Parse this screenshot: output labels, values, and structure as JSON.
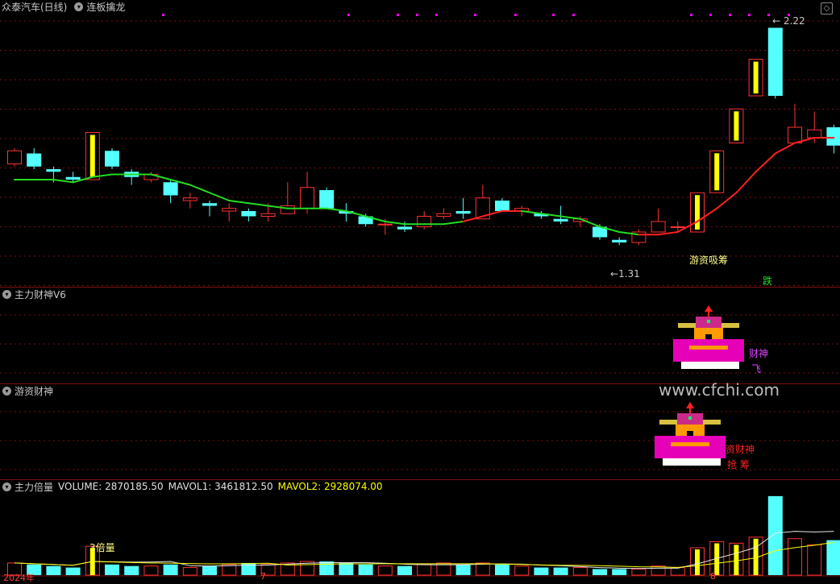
{
  "main": {
    "stock": "众泰汽车(日线)",
    "indicator": "连板擒龙",
    "high_label": "2.22",
    "low_label": "1.31",
    "annotation": "游资吸筹",
    "signal": "跌"
  },
  "panel2": {
    "title": "主力财神V6",
    "figure_text_1": "财神",
    "figure_text_2": "飞"
  },
  "panel3": {
    "title": "游资财神",
    "figure_text_1": "资财神",
    "figure_text_2": "抢 筹"
  },
  "panel4": {
    "title": "主力倍量",
    "volume": "VOLUME: 2870185.50",
    "mavol1": "MAVOL1: 3461812.50",
    "mavol2": "MAVOL2: 2928074.00",
    "marker": "3倍量"
  },
  "axis": {
    "year_label": "2024年",
    "m7": "7",
    "m8": "8"
  },
  "watermark": "www.cfchi.com",
  "colors": {
    "up": "#ff3232",
    "down": "#54ffff",
    "yellow": "#ffff00",
    "magenta": "#ff00ff",
    "ma_green": "#22dd22",
    "ma_red": "#ff2020"
  },
  "chart_data": {
    "type": "candlestick",
    "candles": [
      {
        "o": 1.7,
        "c": 1.75,
        "h": 1.76,
        "l": 1.69
      },
      {
        "o": 1.74,
        "c": 1.69,
        "h": 1.76,
        "l": 1.68
      },
      {
        "o": 1.68,
        "c": 1.67,
        "h": 1.69,
        "l": 1.63
      },
      {
        "o": 1.65,
        "c": 1.64,
        "h": 1.67,
        "l": 1.63
      },
      {
        "o": 1.64,
        "c": 1.82,
        "h": 1.82,
        "l": 1.64,
        "limit": true
      },
      {
        "o": 1.75,
        "c": 1.69,
        "h": 1.76,
        "l": 1.68
      },
      {
        "o": 1.67,
        "c": 1.65,
        "h": 1.68,
        "l": 1.62
      },
      {
        "o": 1.64,
        "c": 1.66,
        "h": 1.67,
        "l": 1.63
      },
      {
        "o": 1.63,
        "c": 1.58,
        "h": 1.64,
        "l": 1.55
      },
      {
        "o": 1.56,
        "c": 1.57,
        "h": 1.59,
        "l": 1.53
      },
      {
        "o": 1.55,
        "c": 1.54,
        "h": 1.56,
        "l": 1.5
      },
      {
        "o": 1.52,
        "c": 1.53,
        "h": 1.55,
        "l": 1.48
      },
      {
        "o": 1.52,
        "c": 1.5,
        "h": 1.53,
        "l": 1.48
      },
      {
        "o": 1.5,
        "c": 1.51,
        "h": 1.55,
        "l": 1.48
      },
      {
        "o": 1.51,
        "c": 1.54,
        "h": 1.63,
        "l": 1.51
      },
      {
        "o": 1.53,
        "c": 1.61,
        "h": 1.67,
        "l": 1.51
      },
      {
        "o": 1.6,
        "c": 1.53,
        "h": 1.61,
        "l": 1.53
      },
      {
        "o": 1.52,
        "c": 1.51,
        "h": 1.55,
        "l": 1.48
      },
      {
        "o": 1.5,
        "c": 1.47,
        "h": 1.51,
        "l": 1.46
      },
      {
        "o": 1.47,
        "c": 1.47,
        "h": 1.49,
        "l": 1.43
      },
      {
        "o": 1.46,
        "c": 1.45,
        "h": 1.48,
        "l": 1.44
      },
      {
        "o": 1.46,
        "c": 1.5,
        "h": 1.52,
        "l": 1.45
      },
      {
        "o": 1.5,
        "c": 1.51,
        "h": 1.53,
        "l": 1.49
      },
      {
        "o": 1.52,
        "c": 1.51,
        "h": 1.57,
        "l": 1.49
      },
      {
        "o": 1.49,
        "c": 1.57,
        "h": 1.62,
        "l": 1.49
      },
      {
        "o": 1.56,
        "c": 1.52,
        "h": 1.57,
        "l": 1.52
      },
      {
        "o": 1.52,
        "c": 1.53,
        "h": 1.54,
        "l": 1.5
      },
      {
        "o": 1.51,
        "c": 1.5,
        "h": 1.52,
        "l": 1.49
      },
      {
        "o": 1.49,
        "c": 1.48,
        "h": 1.54,
        "l": 1.47
      },
      {
        "o": 1.48,
        "c": 1.49,
        "h": 1.5,
        "l": 1.46
      },
      {
        "o": 1.46,
        "c": 1.42,
        "h": 1.47,
        "l": 1.41
      },
      {
        "o": 1.41,
        "c": 1.4,
        "h": 1.42,
        "l": 1.39
      },
      {
        "o": 1.4,
        "c": 1.44,
        "h": 1.45,
        "l": 1.39
      },
      {
        "o": 1.44,
        "c": 1.48,
        "h": 1.53,
        "l": 1.44
      },
      {
        "o": 1.46,
        "c": 1.46,
        "h": 1.48,
        "l": 1.44
      },
      {
        "o": 1.44,
        "c": 1.59,
        "h": 1.59,
        "l": 1.44,
        "limit": true
      },
      {
        "o": 1.59,
        "c": 1.75,
        "h": 1.75,
        "l": 1.59,
        "limit": true
      },
      {
        "o": 1.78,
        "c": 1.91,
        "h": 1.91,
        "l": 1.78,
        "limit": true
      },
      {
        "o": 1.96,
        "c": 2.1,
        "h": 2.1,
        "l": 1.96,
        "limit": true
      },
      {
        "o": 2.22,
        "c": 1.96,
        "h": 2.22,
        "l": 1.95
      },
      {
        "o": 1.78,
        "c": 1.84,
        "h": 1.93,
        "l": 1.78
      },
      {
        "o": 1.8,
        "c": 1.83,
        "h": 1.9,
        "l": 1.78
      },
      {
        "o": 1.84,
        "c": 1.77,
        "h": 1.85,
        "l": 1.74
      }
    ],
    "ma": [
      1.64,
      1.64,
      1.64,
      1.63,
      1.65,
      1.66,
      1.66,
      1.66,
      1.64,
      1.62,
      1.59,
      1.56,
      1.55,
      1.54,
      1.53,
      1.53,
      1.53,
      1.52,
      1.5,
      1.48,
      1.47,
      1.47,
      1.47,
      1.48,
      1.5,
      1.52,
      1.52,
      1.51,
      1.5,
      1.49,
      1.46,
      1.44,
      1.43,
      1.43,
      1.44,
      1.48,
      1.53,
      1.59,
      1.67,
      1.74,
      1.78,
      1.8,
      1.8
    ],
    "volumes": [
      0.8,
      0.7,
      0.6,
      0.5,
      1.9,
      0.7,
      0.6,
      0.6,
      0.7,
      0.5,
      0.6,
      0.7,
      0.8,
      0.7,
      0.8,
      0.9,
      0.9,
      0.8,
      0.7,
      0.6,
      0.6,
      0.7,
      0.8,
      0.7,
      0.8,
      0.7,
      0.6,
      0.5,
      0.5,
      0.5,
      0.4,
      0.4,
      0.4,
      0.6,
      0.5,
      1.8,
      2.2,
      2.1,
      2.5,
      5.2,
      2.4,
      2.0,
      2.3
    ]
  }
}
